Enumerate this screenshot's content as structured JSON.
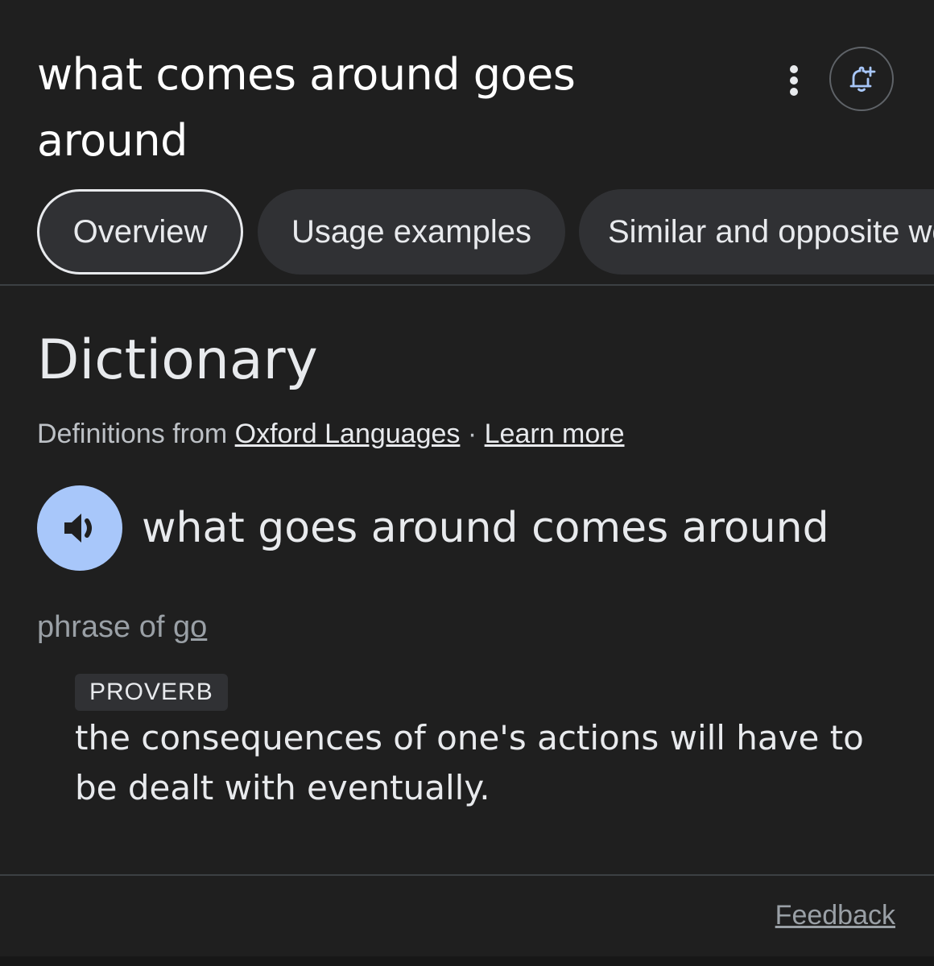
{
  "header": {
    "query": "what comes around goes around",
    "more_icon": "more-vert-icon",
    "alert_icon": "add-alert-icon"
  },
  "tabs": [
    {
      "label": "Overview",
      "active": true
    },
    {
      "label": "Usage examples",
      "active": false
    },
    {
      "label": "Similar and opposite words",
      "active": false
    }
  ],
  "dictionary": {
    "heading": "Dictionary",
    "source_prefix": "Definitions from",
    "source_link": "Oxford Languages",
    "separator": " · ",
    "learn_more": "Learn more",
    "speaker_icon": "volume-icon",
    "headword": "what goes around comes around",
    "phrase_of_prefix": "phrase of ",
    "phrase_of_link": "go",
    "label": "PROVERB",
    "definition": "the consequences of one's actions will have to be dealt with eventually."
  },
  "footer": {
    "feedback": "Feedback"
  },
  "colors": {
    "background": "#1f1f1f",
    "chip_bg": "#303134",
    "accent_blue": "#a8c7fa",
    "text_primary": "#e8eaed",
    "text_secondary": "#9aa0a6"
  }
}
